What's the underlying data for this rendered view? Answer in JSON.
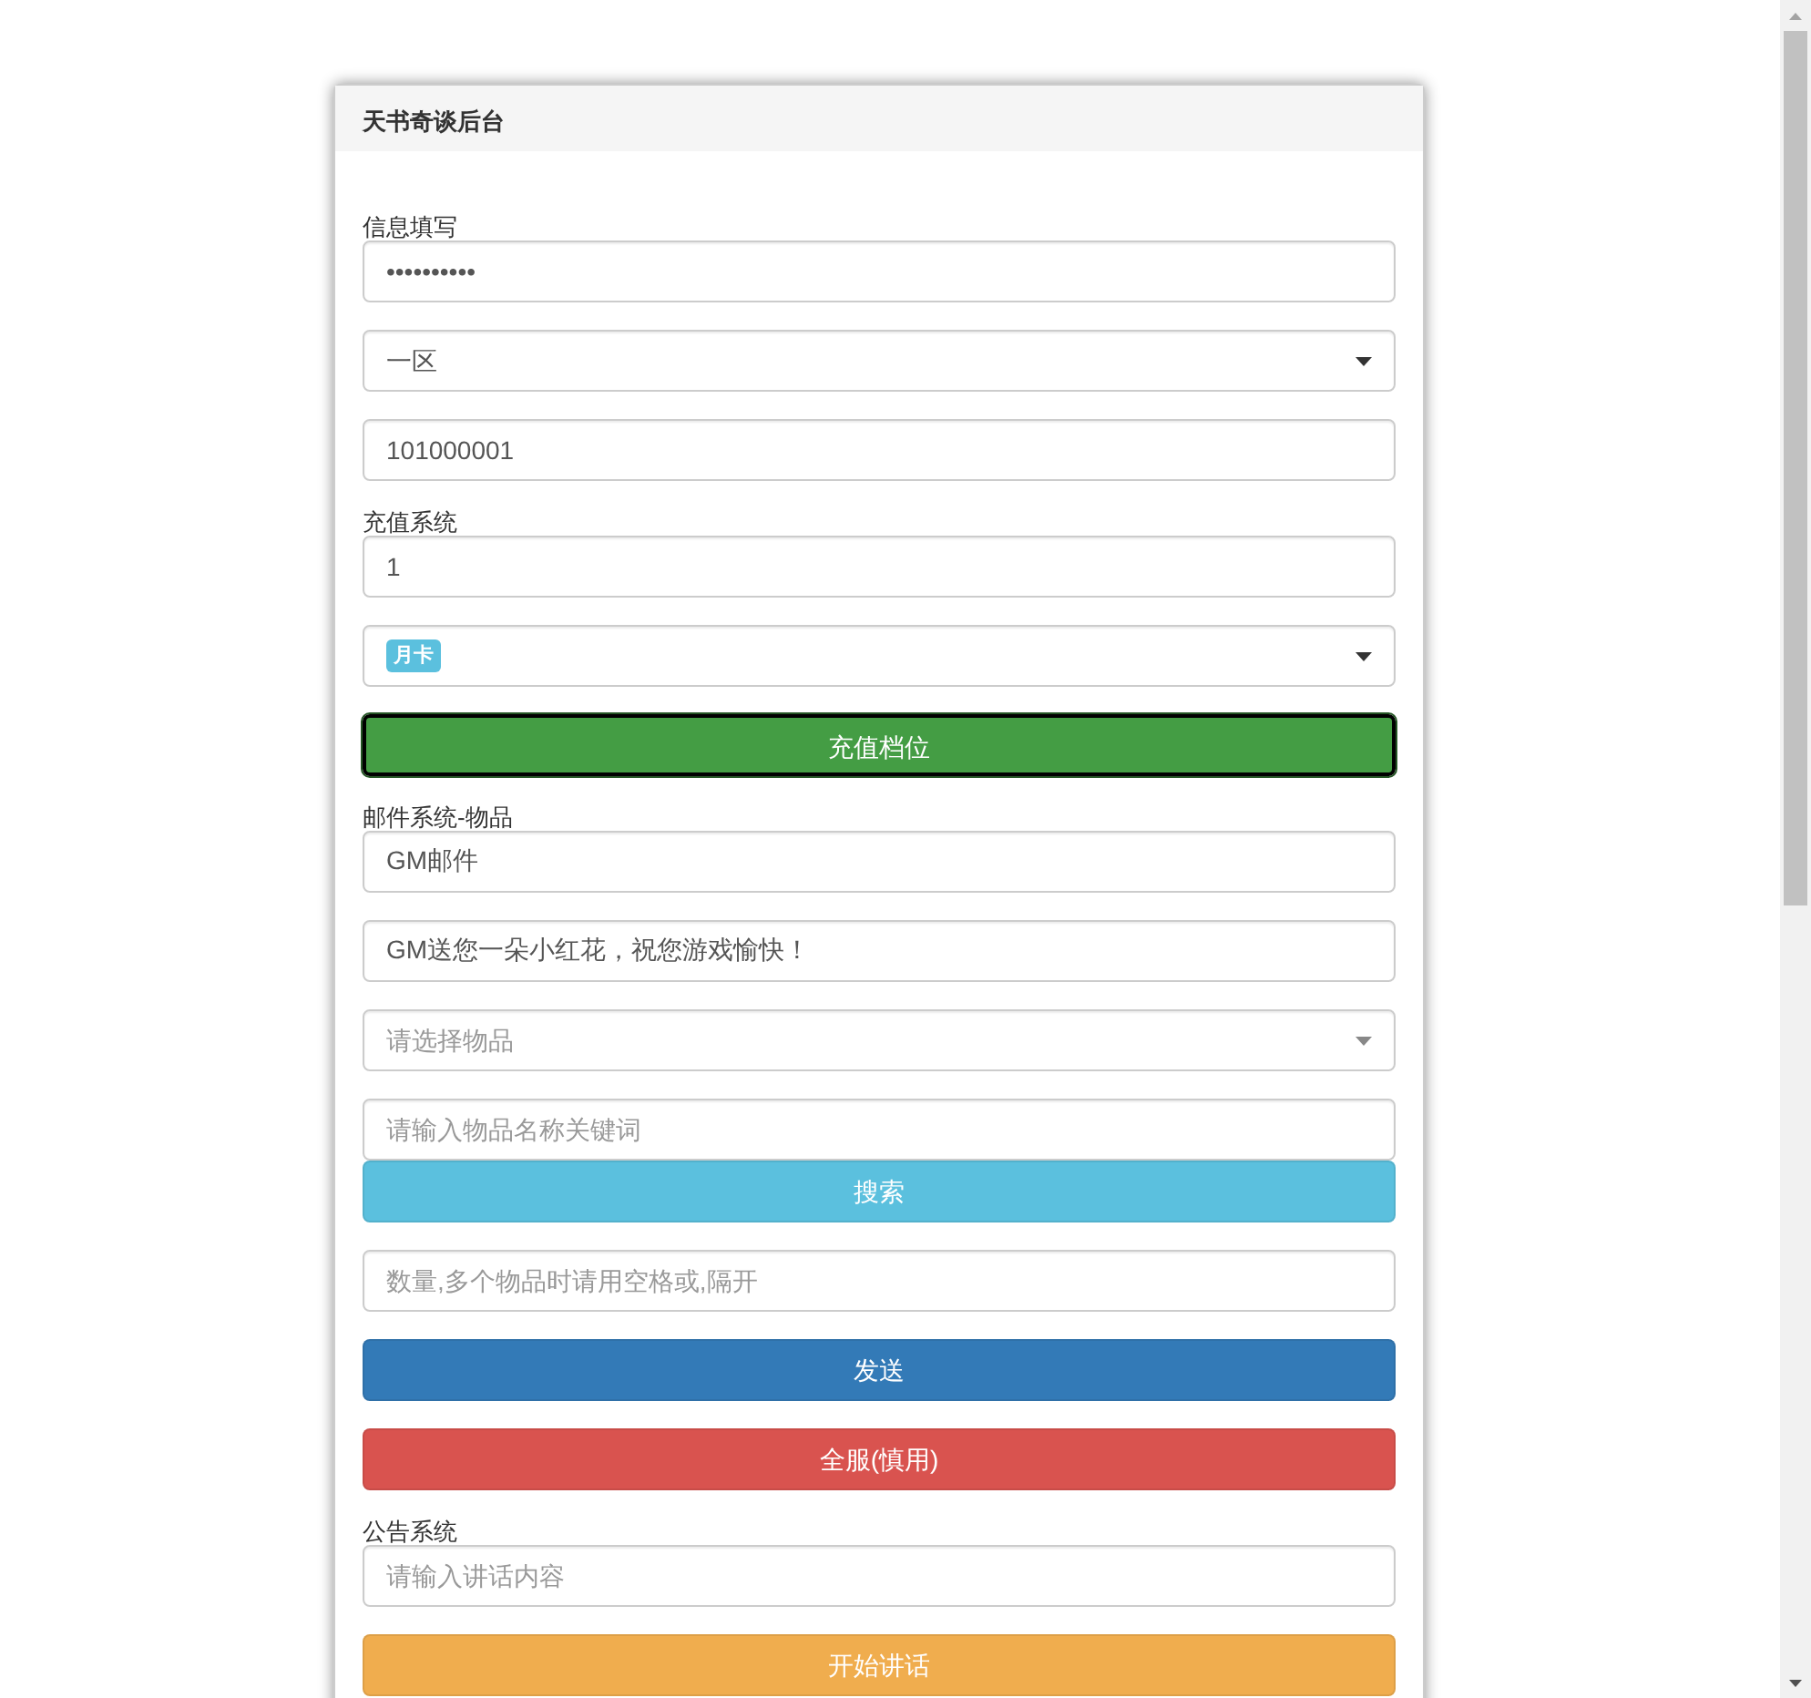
{
  "panel": {
    "title": "天书奇谈后台"
  },
  "sections": [
    {
      "label": "信息填写",
      "controls": [
        {
          "kind": "input",
          "value": "••••••••••"
        },
        {
          "kind": "select",
          "value": "一区"
        },
        {
          "kind": "input",
          "value": "101000001"
        }
      ]
    },
    {
      "label": "充值系统",
      "controls": [
        {
          "kind": "input",
          "value": "1"
        },
        {
          "kind": "select",
          "badge": "月卡"
        },
        {
          "kind": "button",
          "label": "充值档位",
          "color": "#449d44",
          "focused": true
        }
      ]
    },
    {
      "label": "邮件系统-物品",
      "controls": [
        {
          "kind": "input",
          "value": "GM邮件"
        },
        {
          "kind": "input",
          "value": "GM送您一朵小红花，祝您游戏愉快！"
        },
        {
          "kind": "select",
          "placeholder": "请选择物品"
        },
        {
          "kind": "search",
          "placeholder": "请输入物品名称关键词",
          "button": "搜索"
        },
        {
          "kind": "input",
          "placeholder": "数量,多个物品时请用空格或,隔开"
        },
        {
          "kind": "button",
          "label": "发送",
          "color": "#337ab7",
          "focused": false
        },
        {
          "kind": "button",
          "label": "全服(慎用)",
          "color": "#d9534f",
          "focused": false
        }
      ]
    },
    {
      "label": "公告系统",
      "controls": [
        {
          "kind": "input",
          "placeholder": "请输入讲话内容"
        },
        {
          "kind": "button",
          "label": "开始讲话",
          "color": "#f0ad4e",
          "focused": false
        }
      ]
    }
  ]
}
